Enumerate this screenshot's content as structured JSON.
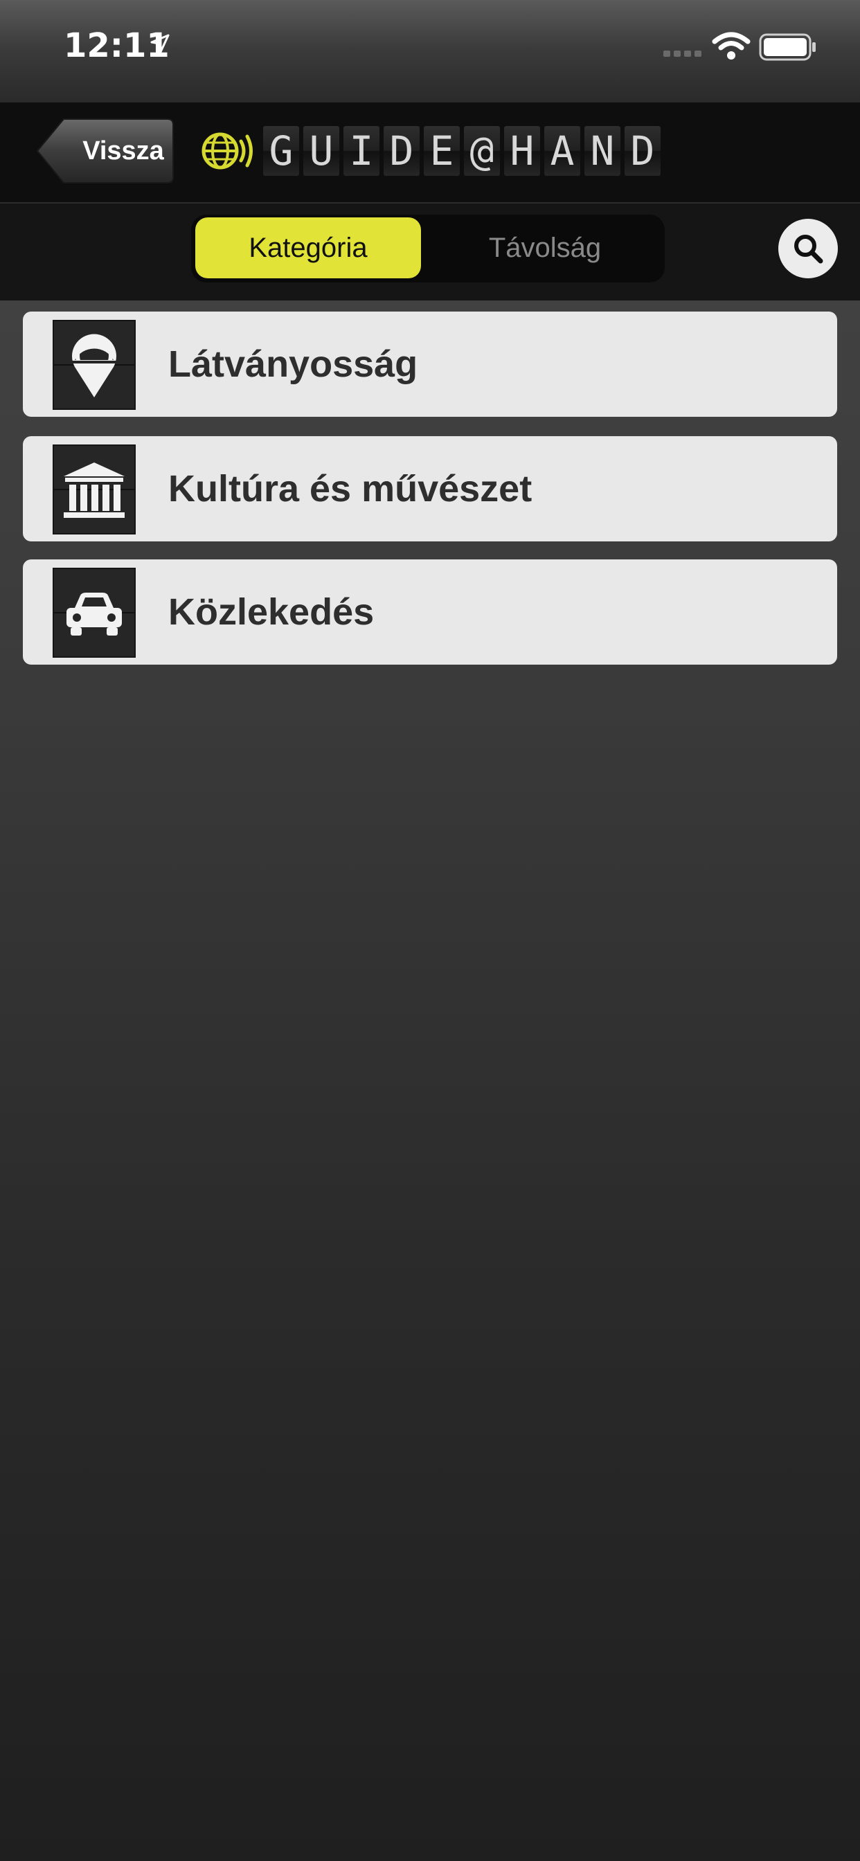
{
  "status_bar": {
    "time": "12:11",
    "icons": [
      "location-arrow-icon",
      "signal-icon",
      "wifi-icon",
      "battery-icon"
    ]
  },
  "nav": {
    "back_label": "Vissza",
    "logo_text": [
      "G",
      "U",
      "I",
      "D",
      "E",
      "@",
      "H",
      "A",
      "N",
      "D"
    ],
    "logo_icon": "globe-sound-icon"
  },
  "filter": {
    "tabs": [
      {
        "label": "Kategória",
        "selected": true
      },
      {
        "label": "Távolság",
        "selected": false
      }
    ],
    "search_icon": "search-icon",
    "accent_color": "#e1e437"
  },
  "categories": [
    {
      "label": "Látványosság",
      "icon": "map-pin-icon"
    },
    {
      "label": "Kultúra és művészet",
      "icon": "museum-icon"
    },
    {
      "label": "Közlekedés",
      "icon": "car-icon"
    }
  ]
}
